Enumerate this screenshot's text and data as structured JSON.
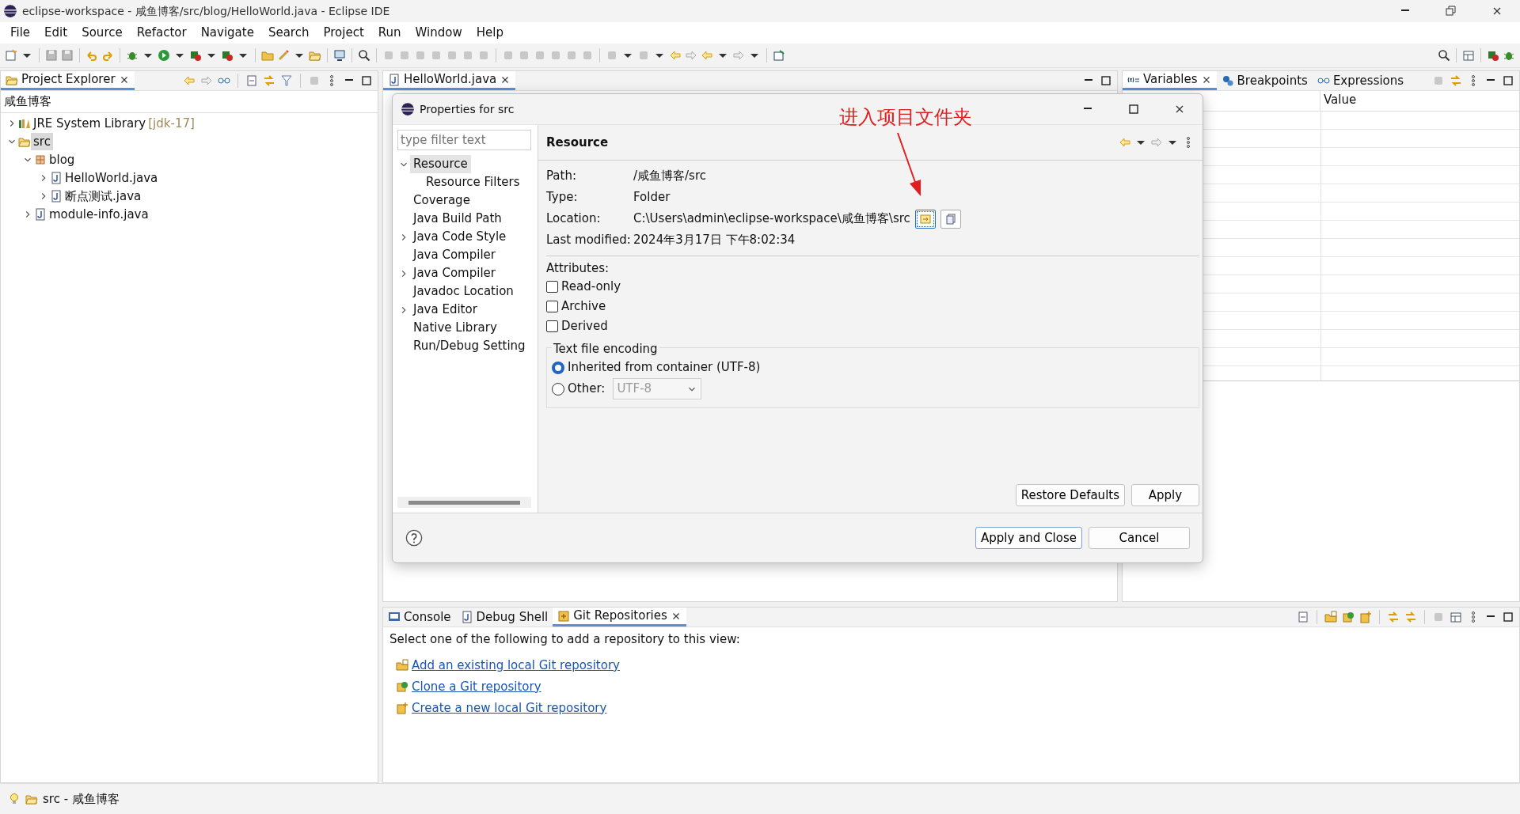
{
  "window": {
    "title": "eclipse-workspace - 咸鱼博客/src/blog/HelloWorld.java - Eclipse IDE"
  },
  "menu": [
    "File",
    "Edit",
    "Source",
    "Refactor",
    "Navigate",
    "Search",
    "Project",
    "Run",
    "Window",
    "Help"
  ],
  "project_explorer": {
    "tabs": [
      {
        "label": "Project Explorer",
        "selected": true
      }
    ],
    "project": "咸鱼博客",
    "tree": [
      {
        "label": "JRE System Library",
        "suffix": "[jdk-17]",
        "kind": "library",
        "expanded": false,
        "selected": false
      },
      {
        "label": "src",
        "kind": "folder",
        "expanded": true,
        "selected": true,
        "children": [
          {
            "label": "blog",
            "kind": "package",
            "expanded": true,
            "selected": false,
            "children": [
              {
                "label": "HelloWorld.java",
                "kind": "java",
                "expanded": false,
                "selected": false
              },
              {
                "label": "断点测试.java",
                "kind": "java",
                "expanded": false,
                "selected": false
              }
            ]
          },
          {
            "label": "module-info.java",
            "kind": "java",
            "expanded": false,
            "selected": false
          }
        ]
      }
    ]
  },
  "editor": {
    "tabs": [
      {
        "label": "HelloWorld.java",
        "selected": true
      }
    ]
  },
  "debug_views": {
    "tabs": [
      {
        "label": "Variables",
        "selected": true,
        "kind": "variables"
      },
      {
        "label": "Breakpoints",
        "selected": false,
        "kind": "breakpoints"
      },
      {
        "label": "Expressions",
        "selected": false,
        "kind": "expressions"
      }
    ],
    "columns": [
      "Value"
    ]
  },
  "dialog": {
    "title": "Properties for src",
    "filter": {
      "placeholder": "type filter text"
    },
    "nav": [
      {
        "label": "Resource",
        "expanded": true,
        "selected": true,
        "children": [
          {
            "label": "Resource Filters",
            "selected": false
          }
        ]
      },
      {
        "label": "Coverage",
        "selected": false
      },
      {
        "label": "Java Build Path",
        "selected": false
      },
      {
        "label": "Java Code Style",
        "expanded": false,
        "selected": false
      },
      {
        "label": "Java Compiler",
        "selected": false
      },
      {
        "label": "Java Compiler",
        "expanded": false,
        "selected": false
      },
      {
        "label": "Javadoc Location",
        "selected": false
      },
      {
        "label": "Java Editor",
        "expanded": false,
        "selected": false
      },
      {
        "label": "Native Library",
        "selected": false
      },
      {
        "label": "Run/Debug Setting",
        "selected": false
      }
    ],
    "page_title": "Resource",
    "fields": [
      {
        "label": "Path:",
        "value": "/咸鱼博客/src"
      },
      {
        "label": "Type:",
        "value": "Folder"
      },
      {
        "label": "Location:",
        "value": "C:\\Users\\admin\\eclipse-workspace\\咸鱼博客\\src"
      },
      {
        "label": "Last modified:",
        "value": "2024年3月17日 下午8:02:34"
      }
    ],
    "attributes_label": "Attributes:",
    "checkboxes": [
      {
        "label": "Read-only",
        "checked": false
      },
      {
        "label": "Archive",
        "checked": false
      },
      {
        "label": "Derived",
        "checked": false
      }
    ],
    "encoding": {
      "legend": "Text file encoding",
      "options": [
        {
          "label": "Inherited from container (UTF-8)",
          "selected": true
        },
        {
          "label": "Other:",
          "selected": false
        }
      ],
      "other": {
        "value": "UTF-8",
        "disabled": true
      }
    },
    "page_buttons": [
      "Restore Defaults",
      "Apply"
    ],
    "buttons": [
      {
        "label": "Apply and Close",
        "default": true
      },
      {
        "label": "Cancel",
        "default": false
      }
    ],
    "annotation": {
      "text": "进入项目文件夹"
    }
  },
  "bottom_panel": {
    "tabs": [
      {
        "label": "Console",
        "selected": false,
        "kind": "console"
      },
      {
        "label": "Debug Shell",
        "selected": false,
        "kind": "java"
      },
      {
        "label": "Git Repositories",
        "selected": true,
        "kind": "git"
      }
    ],
    "message": "Select one of the following to add a repository to this view:",
    "links": [
      {
        "label": "Add an existing local Git repository",
        "kind": "add"
      },
      {
        "label": "Clone a Git repository",
        "kind": "clone"
      },
      {
        "label": "Create a new local Git repository",
        "kind": "create"
      }
    ]
  },
  "status_bar": {
    "text": "src - 咸鱼博客"
  }
}
